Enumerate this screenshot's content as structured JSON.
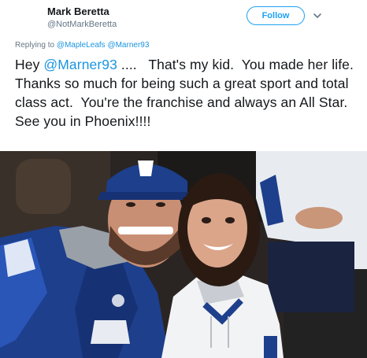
{
  "author": {
    "name": "Mark Beretta",
    "handle": "@NotMarkBeretta"
  },
  "actions": {
    "follow_label": "Follow",
    "more_icon": "chevron-down-icon"
  },
  "reply": {
    "prefix": "Replying to",
    "mentions": [
      "@MapleLeafs",
      "@Marner93"
    ]
  },
  "tweet": {
    "greeting": "Hey",
    "mention": "@Marner93",
    "body": " ....   That's my kid.  You made her life.  Thanks so much for being such a great sport and total class act.  You're the franchise and always an All Star.  See you in Phoenix!!!!"
  },
  "colors": {
    "link": "#1b95e0",
    "follow": "#1da1f2",
    "secondary_text": "#657786",
    "leafs_blue": "#1d3f8c"
  }
}
